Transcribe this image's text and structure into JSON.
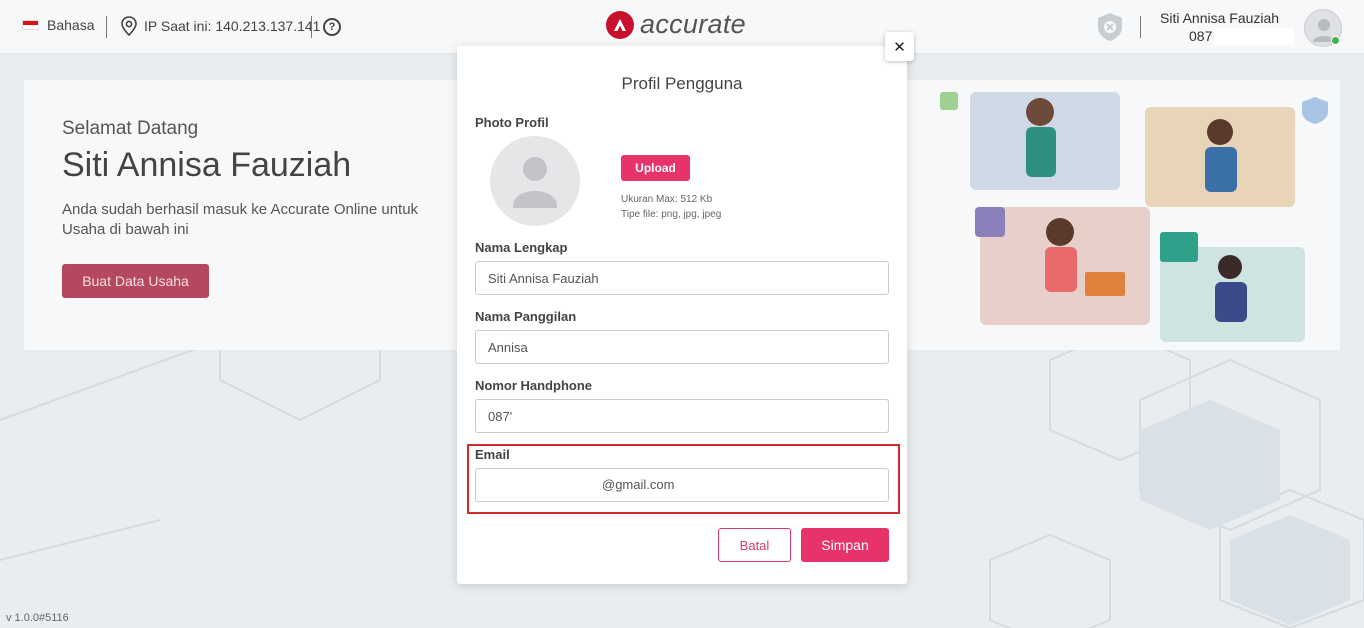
{
  "topbar": {
    "language_label": "Bahasa",
    "ip_label": "IP Saat ini: 140.213.137.141",
    "help_glyph": "?",
    "logo_text": "accurate",
    "user_name": "Siti Annisa Fauziah",
    "user_phone": "087"
  },
  "welcome": {
    "greeting": "Selamat Datang",
    "name": "Siti Annisa Fauziah",
    "description": "Anda sudah berhasil masuk ke Accurate Online untuk Usaha di bawah ini",
    "create_button": "Buat Data Usaha"
  },
  "version": "v 1.0.0#5116",
  "modal": {
    "title": "Profil Pengguna",
    "close_glyph": "✕",
    "photo_label": "Photo Profil",
    "upload_button": "Upload",
    "max_size_note": "Ukuran Max: 512 Kb",
    "file_type_note": "Tipe file: png, jpg, jpeg",
    "full_name_label": "Nama Lengkap",
    "full_name_value": "Siti Annisa Fauziah",
    "nickname_label": "Nama Panggilan",
    "nickname_value": "Annisa",
    "phone_label": "Nomor Handphone",
    "phone_value": "087'",
    "email_label": "Email",
    "email_value": "@gmail.com",
    "cancel_button": "Batal",
    "save_button": "Simpan"
  },
  "colors": {
    "brand": "#c8102e",
    "primary_button": "#e8336a",
    "highlight_border": "#d32a2a"
  }
}
